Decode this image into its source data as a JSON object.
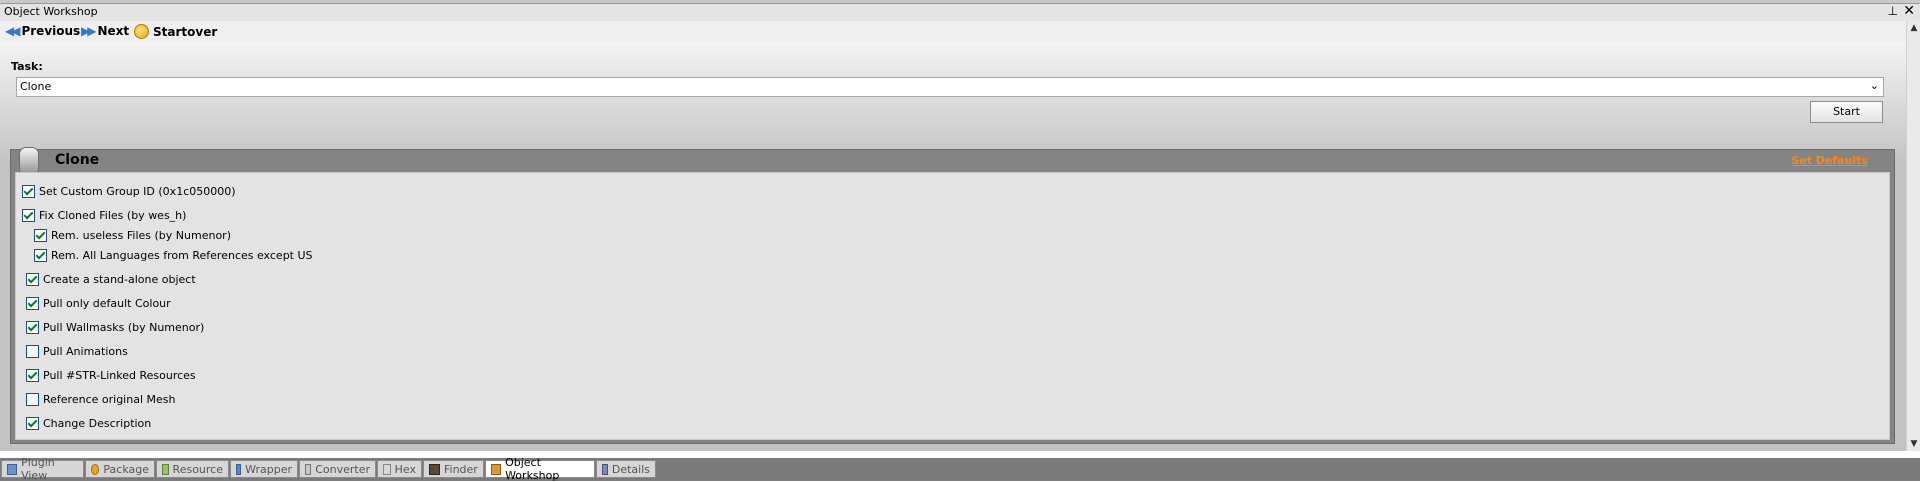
{
  "panel": {
    "title": "Object Workshop"
  },
  "nav": {
    "previous": "Previous",
    "next": "Next",
    "startover": "Startover"
  },
  "task": {
    "label": "Task:",
    "value": "Clone",
    "start_label": "Start"
  },
  "group": {
    "title": "Clone",
    "set_defaults": "Set Defaults",
    "options": [
      {
        "label": "Set Custom Group ID (0x1c050000)",
        "checked": true
      },
      {
        "label": "Fix Cloned Files (by wes_h)",
        "checked": true
      },
      {
        "label": "Rem. useless Files (by  Numenor)",
        "checked": true
      },
      {
        "label": "Rem. All Languages from References except US",
        "checked": true
      },
      {
        "label": "Create a stand-alone object",
        "checked": true
      },
      {
        "label": "Pull only default Colour",
        "checked": true
      },
      {
        "label": "Pull Wallmasks (by Numenor)",
        "checked": true
      },
      {
        "label": "Pull Animations",
        "checked": false
      },
      {
        "label": "Pull #STR-Linked Resources",
        "checked": true
      },
      {
        "label": "Reference original Mesh",
        "checked": false
      },
      {
        "label": "Change Description",
        "checked": true
      }
    ]
  },
  "tabs": [
    {
      "label": "Plugin View",
      "icon": "plugin-icon"
    },
    {
      "label": "Package",
      "icon": "package-icon"
    },
    {
      "label": "Resource",
      "icon": "resource-icon"
    },
    {
      "label": "Wrapper",
      "icon": "wrapper-icon"
    },
    {
      "label": "Converter",
      "icon": "converter-icon"
    },
    {
      "label": "Hex",
      "icon": "hex-icon"
    },
    {
      "label": "Finder",
      "icon": "binoculars-icon"
    },
    {
      "label": "Object Workshop",
      "icon": "workshop-icon",
      "active": true
    },
    {
      "label": "Details",
      "icon": "details-icon"
    }
  ]
}
